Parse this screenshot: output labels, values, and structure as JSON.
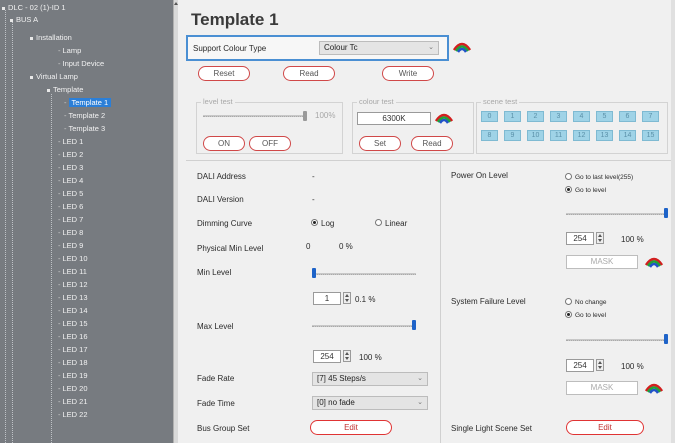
{
  "sidebar": {
    "items": [
      {
        "label": "DLC - 02 (1)-ID 1",
        "bullet": true
      },
      {
        "label": "BUS A",
        "bullet": true
      },
      {
        "label": "Installation",
        "bullet": true
      },
      {
        "label": "Lamp",
        "bullet": false
      },
      {
        "label": "Input Device",
        "bullet": false
      },
      {
        "label": "Virtual Lamp",
        "bullet": true
      },
      {
        "label": "Template",
        "bullet": true
      },
      {
        "label": "Template 1",
        "bullet": false,
        "selected": true
      },
      {
        "label": "Template 2",
        "bullet": false
      },
      {
        "label": "Template 3",
        "bullet": false
      },
      {
        "label": "LED 1"
      },
      {
        "label": "LED 2"
      },
      {
        "label": "LED 3"
      },
      {
        "label": "LED 4"
      },
      {
        "label": "LED 5"
      },
      {
        "label": "LED 6"
      },
      {
        "label": "LED 7"
      },
      {
        "label": "LED 8"
      },
      {
        "label": "LED 9"
      },
      {
        "label": "LED 10"
      },
      {
        "label": "LED 11"
      },
      {
        "label": "LED 12"
      },
      {
        "label": "LED 13"
      },
      {
        "label": "LED 14"
      },
      {
        "label": "LED 15"
      },
      {
        "label": "LED 16"
      },
      {
        "label": "LED 17"
      },
      {
        "label": "LED 18"
      },
      {
        "label": "LED 19"
      },
      {
        "label": "LED 20"
      },
      {
        "label": "LED 21"
      },
      {
        "label": "LED 22"
      }
    ]
  },
  "title": "Template 1",
  "support": {
    "label": "Support Colour Type",
    "value": "Colour Tc",
    "icon": "colour-wheel-icon"
  },
  "toolbar": {
    "reset": "Reset",
    "read": "Read",
    "write": "Write"
  },
  "level_test": {
    "title": "level test",
    "percent": "100%",
    "level_fraction": 1.0,
    "on": "ON",
    "off": "OFF"
  },
  "colour_test": {
    "title": "colour test",
    "value": "6300K",
    "set": "Set",
    "read": "Read"
  },
  "scene_test": {
    "title": "scene test",
    "scenes": [
      "0",
      "1",
      "2",
      "3",
      "4",
      "5",
      "6",
      "7",
      "8",
      "9",
      "10",
      "11",
      "12",
      "13",
      "14",
      "15"
    ]
  },
  "left": {
    "dali_address": {
      "label": "DALI Address",
      "value": "-"
    },
    "dali_version": {
      "label": "DALI Version",
      "value": "-"
    },
    "dimming_curve": {
      "label": "Dimming Curve",
      "log": "Log",
      "linear": "Linear",
      "selected": "log"
    },
    "physical_min": {
      "label": "Physical Min Level",
      "value": "0",
      "percent": "0 %"
    },
    "min_level": {
      "label": "Min Level",
      "value": "1",
      "percent": "0.1 %",
      "level_fraction": 0.0
    },
    "max_level": {
      "label": "Max Level",
      "value": "254",
      "percent": "100 %",
      "level_fraction": 1.0
    },
    "fade_rate": {
      "label": "Fade Rate",
      "value": "[7] 45 Steps/s"
    },
    "fade_time": {
      "label": "Fade Time",
      "value": "[0] no fade"
    },
    "bus_group": {
      "label": "Bus Group Set",
      "button": "Edit"
    }
  },
  "right": {
    "power_on": {
      "label": "Power On Level",
      "opt1": "Go to last level(255)",
      "opt2": "Go to level",
      "selected": "opt2",
      "value": "254",
      "percent": "100 %",
      "mask": "MASK",
      "level_fraction": 1.0
    },
    "system_failure": {
      "label": "System Failure Level",
      "opt1": "No change",
      "opt2": "Go to level",
      "selected": "opt2",
      "value": "254",
      "percent": "100 %",
      "mask": "MASK",
      "level_fraction": 1.0
    },
    "single_scene": {
      "label": "Single Light Scene Set",
      "button": "Edit"
    }
  },
  "colors": {
    "accent": "#4a8fd3",
    "selection": "#2b7fd8",
    "edit_red": "#e03434",
    "slider_blue": "#1e63c8",
    "scene_cyan": "#9fd3e7"
  }
}
